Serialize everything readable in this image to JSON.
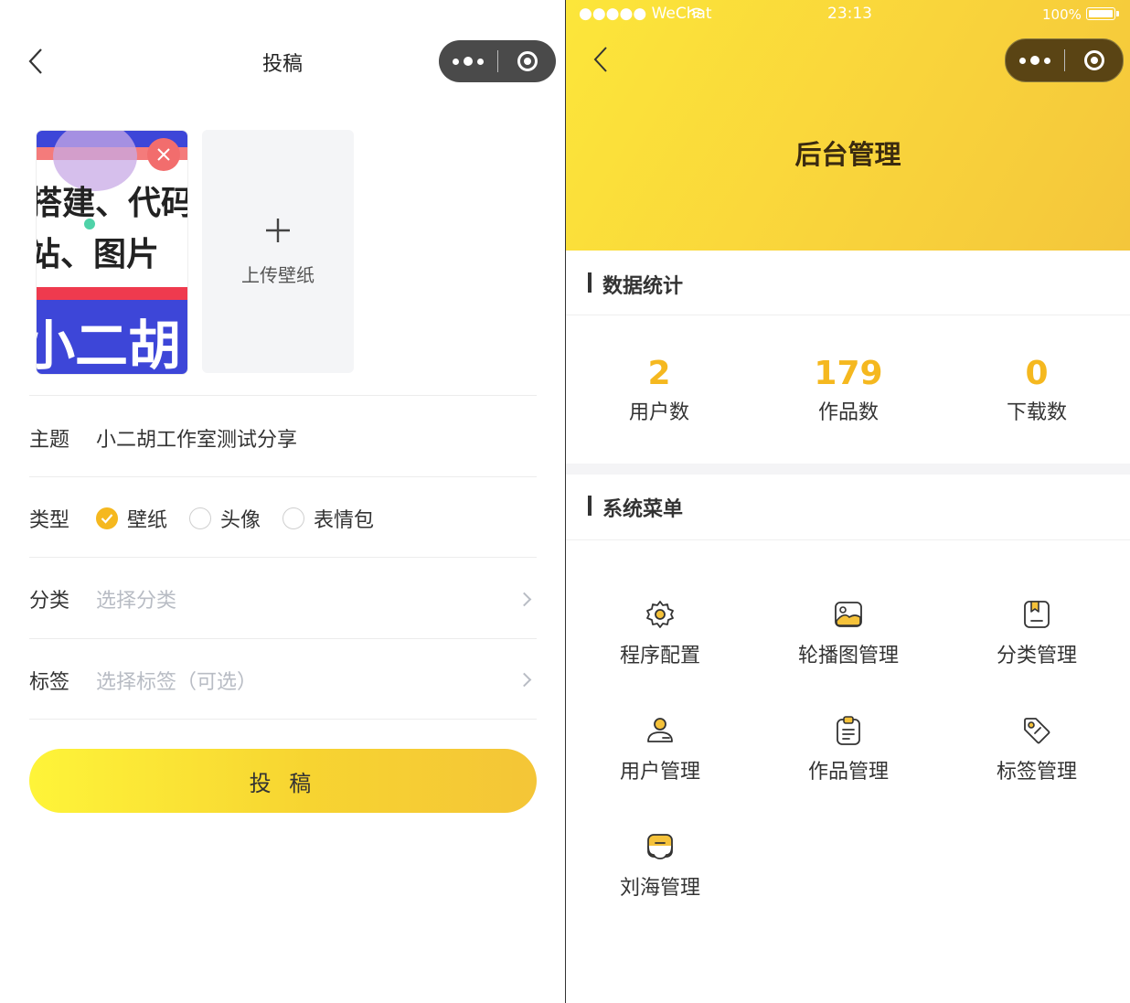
{
  "left": {
    "title": "投稿",
    "upload_label": "上传壁纸",
    "thumb_lines": [
      "搭建、代码",
      "站、图片",
      "小二胡"
    ],
    "form": {
      "subject_label": "主题",
      "subject_value": "小二胡工作室测试分享",
      "type_label": "类型",
      "type_options": [
        "壁纸",
        "头像",
        "表情包"
      ],
      "type_selected": "壁纸",
      "category_label": "分类",
      "category_placeholder": "选择分类",
      "tags_label": "标签",
      "tags_placeholder": "选择标签（可选）"
    },
    "submit_label": "投 稿"
  },
  "right": {
    "status_bar": {
      "carrier": "●●●●● WeChat",
      "time": "23:13",
      "battery": "100%"
    },
    "title": "后台管理",
    "stats_section_title": "数据统计",
    "stats": [
      {
        "value": "2",
        "label": "用户数"
      },
      {
        "value": "179",
        "label": "作品数"
      },
      {
        "value": "0",
        "label": "下载数"
      }
    ],
    "menu_section_title": "系统菜单",
    "menu": [
      {
        "label": "程序配置",
        "icon": "gear-icon"
      },
      {
        "label": "轮播图管理",
        "icon": "image-icon"
      },
      {
        "label": "分类管理",
        "icon": "category-icon"
      },
      {
        "label": "用户管理",
        "icon": "user-icon"
      },
      {
        "label": "作品管理",
        "icon": "clipboard-icon"
      },
      {
        "label": "标签管理",
        "icon": "tag-icon"
      },
      {
        "label": "刘海管理",
        "icon": "notch-icon"
      }
    ]
  },
  "colors": {
    "accent": "#f5b81f",
    "header_gradient_start": "#fce63a",
    "header_gradient_end": "#f4c63b",
    "delete_badge": "#f26d6d",
    "placeholder": "#b8bcc4"
  }
}
